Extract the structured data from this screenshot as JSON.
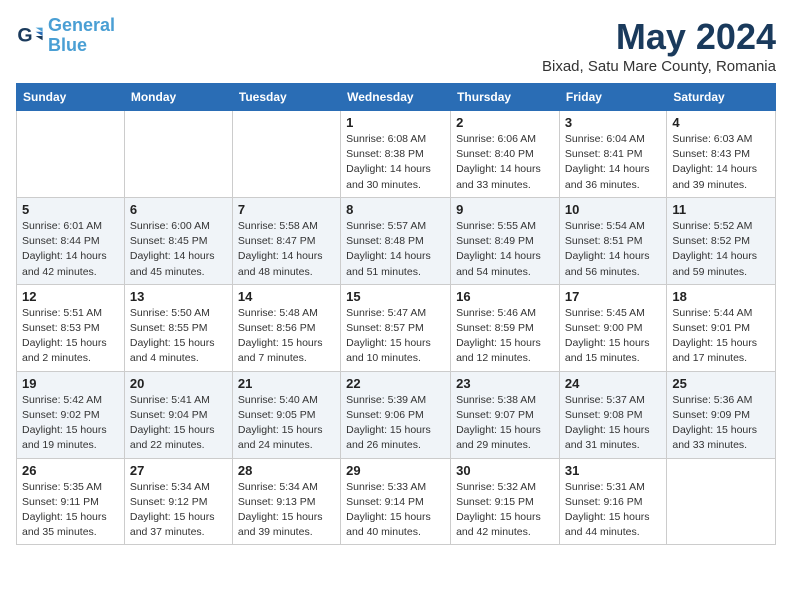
{
  "header": {
    "logo_line1": "General",
    "logo_line2": "Blue",
    "month_title": "May 2024",
    "location": "Bixad, Satu Mare County, Romania"
  },
  "days_of_week": [
    "Sunday",
    "Monday",
    "Tuesday",
    "Wednesday",
    "Thursday",
    "Friday",
    "Saturday"
  ],
  "weeks": [
    [
      {
        "day": "",
        "info": ""
      },
      {
        "day": "",
        "info": ""
      },
      {
        "day": "",
        "info": ""
      },
      {
        "day": "1",
        "info": "Sunrise: 6:08 AM\nSunset: 8:38 PM\nDaylight: 14 hours\nand 30 minutes."
      },
      {
        "day": "2",
        "info": "Sunrise: 6:06 AM\nSunset: 8:40 PM\nDaylight: 14 hours\nand 33 minutes."
      },
      {
        "day": "3",
        "info": "Sunrise: 6:04 AM\nSunset: 8:41 PM\nDaylight: 14 hours\nand 36 minutes."
      },
      {
        "day": "4",
        "info": "Sunrise: 6:03 AM\nSunset: 8:43 PM\nDaylight: 14 hours\nand 39 minutes."
      }
    ],
    [
      {
        "day": "5",
        "info": "Sunrise: 6:01 AM\nSunset: 8:44 PM\nDaylight: 14 hours\nand 42 minutes."
      },
      {
        "day": "6",
        "info": "Sunrise: 6:00 AM\nSunset: 8:45 PM\nDaylight: 14 hours\nand 45 minutes."
      },
      {
        "day": "7",
        "info": "Sunrise: 5:58 AM\nSunset: 8:47 PM\nDaylight: 14 hours\nand 48 minutes."
      },
      {
        "day": "8",
        "info": "Sunrise: 5:57 AM\nSunset: 8:48 PM\nDaylight: 14 hours\nand 51 minutes."
      },
      {
        "day": "9",
        "info": "Sunrise: 5:55 AM\nSunset: 8:49 PM\nDaylight: 14 hours\nand 54 minutes."
      },
      {
        "day": "10",
        "info": "Sunrise: 5:54 AM\nSunset: 8:51 PM\nDaylight: 14 hours\nand 56 minutes."
      },
      {
        "day": "11",
        "info": "Sunrise: 5:52 AM\nSunset: 8:52 PM\nDaylight: 14 hours\nand 59 minutes."
      }
    ],
    [
      {
        "day": "12",
        "info": "Sunrise: 5:51 AM\nSunset: 8:53 PM\nDaylight: 15 hours\nand 2 minutes."
      },
      {
        "day": "13",
        "info": "Sunrise: 5:50 AM\nSunset: 8:55 PM\nDaylight: 15 hours\nand 4 minutes."
      },
      {
        "day": "14",
        "info": "Sunrise: 5:48 AM\nSunset: 8:56 PM\nDaylight: 15 hours\nand 7 minutes."
      },
      {
        "day": "15",
        "info": "Sunrise: 5:47 AM\nSunset: 8:57 PM\nDaylight: 15 hours\nand 10 minutes."
      },
      {
        "day": "16",
        "info": "Sunrise: 5:46 AM\nSunset: 8:59 PM\nDaylight: 15 hours\nand 12 minutes."
      },
      {
        "day": "17",
        "info": "Sunrise: 5:45 AM\nSunset: 9:00 PM\nDaylight: 15 hours\nand 15 minutes."
      },
      {
        "day": "18",
        "info": "Sunrise: 5:44 AM\nSunset: 9:01 PM\nDaylight: 15 hours\nand 17 minutes."
      }
    ],
    [
      {
        "day": "19",
        "info": "Sunrise: 5:42 AM\nSunset: 9:02 PM\nDaylight: 15 hours\nand 19 minutes."
      },
      {
        "day": "20",
        "info": "Sunrise: 5:41 AM\nSunset: 9:04 PM\nDaylight: 15 hours\nand 22 minutes."
      },
      {
        "day": "21",
        "info": "Sunrise: 5:40 AM\nSunset: 9:05 PM\nDaylight: 15 hours\nand 24 minutes."
      },
      {
        "day": "22",
        "info": "Sunrise: 5:39 AM\nSunset: 9:06 PM\nDaylight: 15 hours\nand 26 minutes."
      },
      {
        "day": "23",
        "info": "Sunrise: 5:38 AM\nSunset: 9:07 PM\nDaylight: 15 hours\nand 29 minutes."
      },
      {
        "day": "24",
        "info": "Sunrise: 5:37 AM\nSunset: 9:08 PM\nDaylight: 15 hours\nand 31 minutes."
      },
      {
        "day": "25",
        "info": "Sunrise: 5:36 AM\nSunset: 9:09 PM\nDaylight: 15 hours\nand 33 minutes."
      }
    ],
    [
      {
        "day": "26",
        "info": "Sunrise: 5:35 AM\nSunset: 9:11 PM\nDaylight: 15 hours\nand 35 minutes."
      },
      {
        "day": "27",
        "info": "Sunrise: 5:34 AM\nSunset: 9:12 PM\nDaylight: 15 hours\nand 37 minutes."
      },
      {
        "day": "28",
        "info": "Sunrise: 5:34 AM\nSunset: 9:13 PM\nDaylight: 15 hours\nand 39 minutes."
      },
      {
        "day": "29",
        "info": "Sunrise: 5:33 AM\nSunset: 9:14 PM\nDaylight: 15 hours\nand 40 minutes."
      },
      {
        "day": "30",
        "info": "Sunrise: 5:32 AM\nSunset: 9:15 PM\nDaylight: 15 hours\nand 42 minutes."
      },
      {
        "day": "31",
        "info": "Sunrise: 5:31 AM\nSunset: 9:16 PM\nDaylight: 15 hours\nand 44 minutes."
      },
      {
        "day": "",
        "info": ""
      }
    ]
  ]
}
